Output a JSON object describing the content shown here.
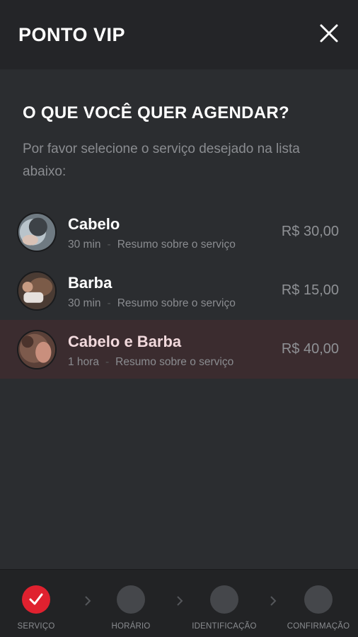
{
  "header": {
    "title": "PONTO VIP",
    "close_icon": "close-icon"
  },
  "main": {
    "heading": "O QUE VOCÊ QUER AGENDAR?",
    "subtitle": "Por favor selecione o serviço desejado na lista abaixo:"
  },
  "services": [
    {
      "name": "Cabelo",
      "duration": "30 min",
      "summary": "Resumo sobre o serviço",
      "price": "R$ 30,00",
      "selected": false
    },
    {
      "name": "Barba",
      "duration": "30 min",
      "summary": "Resumo sobre o serviço",
      "price": "R$ 15,00",
      "selected": false
    },
    {
      "name": "Cabelo e Barba",
      "duration": "1 hora",
      "summary": "Resumo sobre o serviço",
      "price": "R$ 40,00",
      "selected": true
    }
  ],
  "stepper": {
    "steps": [
      {
        "label": "SERVIÇO",
        "state": "done",
        "icon": "check-icon"
      },
      {
        "label": "HORÁRIO",
        "state": "pending"
      },
      {
        "label": "IDENTIFICAÇÃO",
        "state": "pending"
      },
      {
        "label": "CONFIRMAÇÃO",
        "state": "pending"
      }
    ],
    "separator_icon": "chevron-right-icon"
  },
  "colors": {
    "background": "#2b2d30",
    "header": "#242528",
    "accent": "#e0212f",
    "selected_row": "#3b2c2f",
    "muted_text": "#8a8c90"
  }
}
